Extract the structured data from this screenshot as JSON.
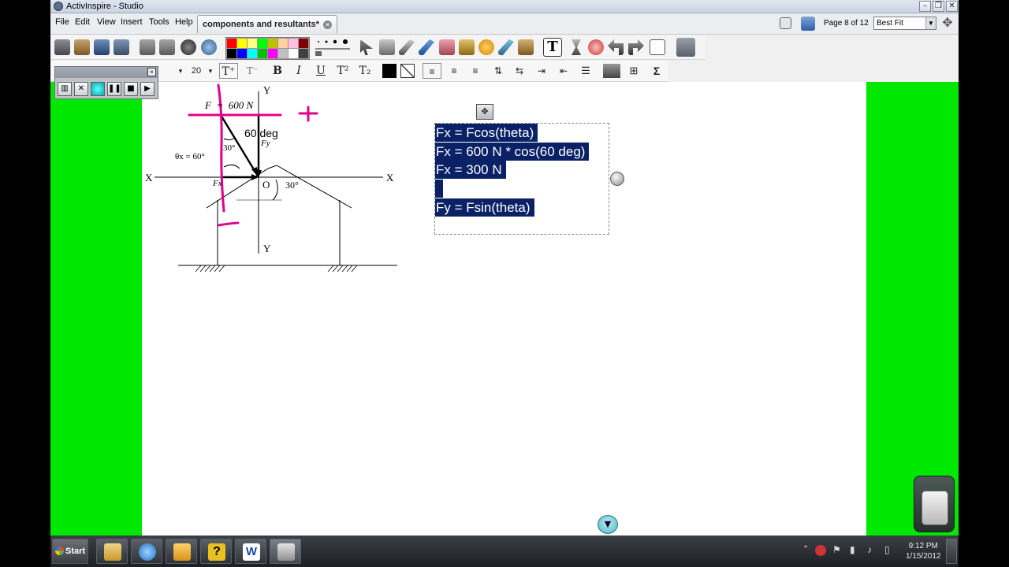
{
  "window": {
    "title": "ActivInspire - Studio"
  },
  "menu": {
    "items": [
      "File",
      "Edit",
      "View",
      "Insert",
      "Tools",
      "Help"
    ]
  },
  "doc_tab": {
    "label": "components and resultants*"
  },
  "page_indicator": "Page 8 of 12",
  "zoom": {
    "selected": "Best Fit"
  },
  "text_toolbar": {
    "font_size": "20",
    "bold": "B",
    "italic": "I",
    "underline": "U",
    "sigma": "Σ"
  },
  "palette_colors": [
    "#ff0000",
    "#ffff00",
    "#ffff80",
    "#00ff00",
    "#c0c000",
    "#ffd0a0",
    "#ffc0e0",
    "#800000",
    "#000000",
    "#0000ff",
    "#00ffff",
    "#00c000",
    "#ff00ff",
    "#c0c0c0",
    "#ffffff",
    "#404040"
  ],
  "diagram": {
    "force_label": "F  =  600 N",
    "angle_annotation": "60 deg",
    "fy_label": "Fy",
    "fx_label": "Fx",
    "theta_label": "θx = 60°",
    "angle_30_a": "30°",
    "angle_30_b": "30°",
    "axis_x_left": "X",
    "axis_x_right": "X",
    "axis_y_top": "Y",
    "axis_y_bottom": "Y",
    "origin": "O"
  },
  "equations": [
    "Fx = Fcos(theta)",
    "Fx = 600 N * cos(60 deg)",
    "Fx = 300 N",
    " ",
    "Fy = Fsin(theta)"
  ],
  "taskbar": {
    "start_label": "Start"
  },
  "clock": {
    "time": "9:12 PM",
    "date": "1/15/2012"
  },
  "colors": {
    "page_background": "#00e800",
    "selection_highlight": "#0a2166",
    "ink": "#e0008c"
  }
}
